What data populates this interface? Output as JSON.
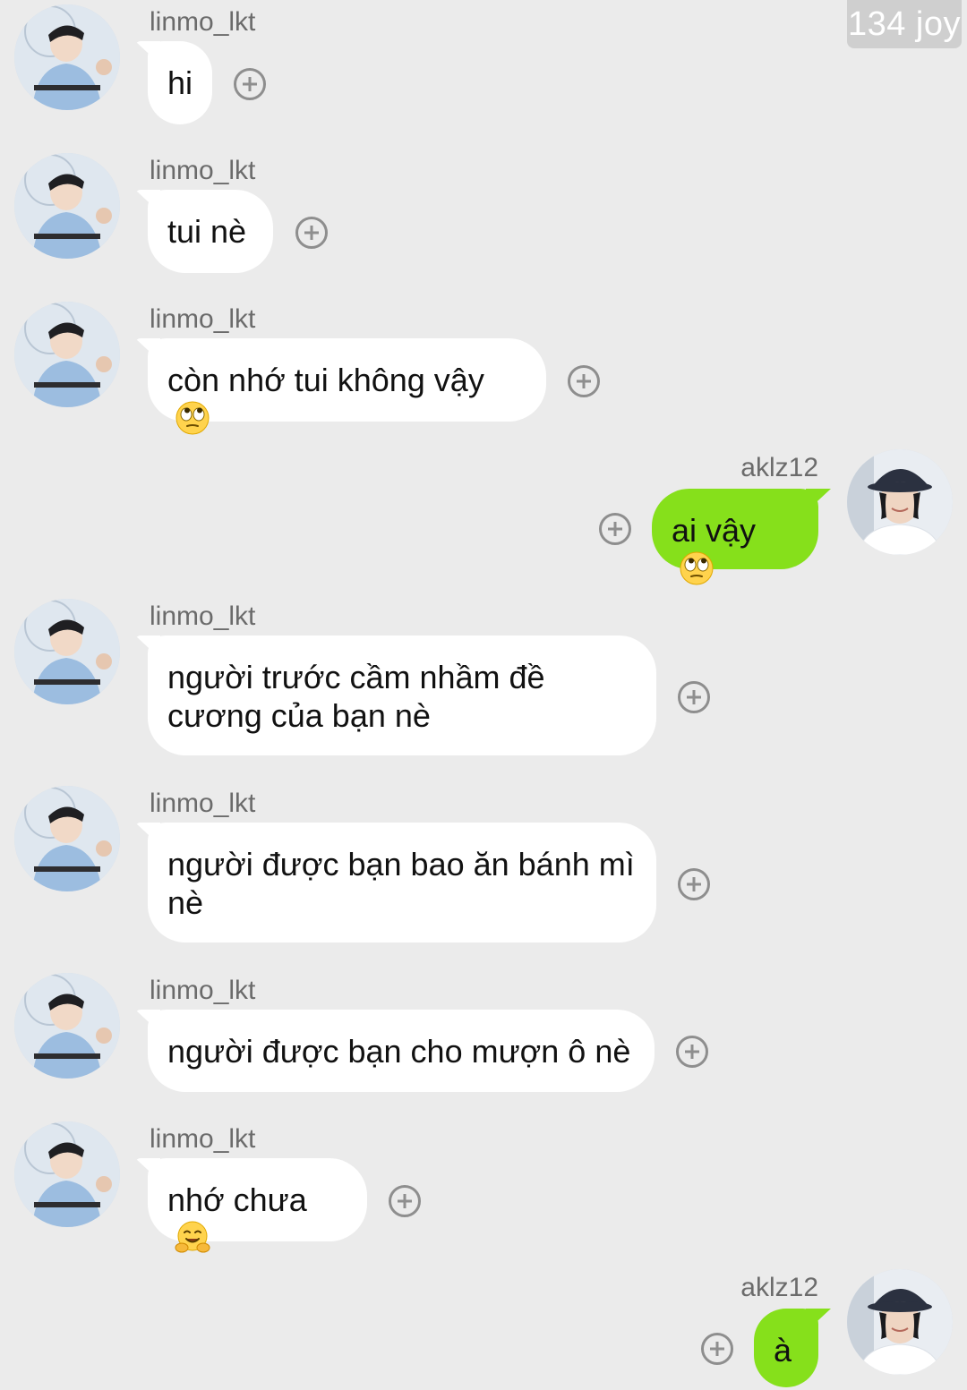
{
  "watermark": "134 joy",
  "messages": [
    {
      "sender": "linmo_lkt",
      "text": "hi",
      "emoji": "",
      "direction": "incoming"
    },
    {
      "sender": "linmo_lkt",
      "text": "tui nè",
      "emoji": "",
      "direction": "incoming"
    },
    {
      "sender": "linmo_lkt",
      "text": "còn nhớ tui không vậy",
      "emoji": "eye-roll-emoji",
      "direction": "incoming"
    },
    {
      "sender": "aklz12",
      "text": "ai vậy",
      "emoji": "eye-roll-emoji",
      "direction": "outgoing"
    },
    {
      "sender": "linmo_lkt",
      "text": "người trước cầm nhầm đề cương của bạn nè",
      "emoji": "",
      "direction": "incoming"
    },
    {
      "sender": "linmo_lkt",
      "text": "người được bạn bao ăn bánh mì nè",
      "emoji": "",
      "direction": "incoming"
    },
    {
      "sender": "linmo_lkt",
      "text": "người được bạn cho mượn ô nè",
      "emoji": "",
      "direction": "incoming"
    },
    {
      "sender": "linmo_lkt",
      "text": "nhớ chưa",
      "emoji": "hugging-face-emoji",
      "direction": "incoming"
    },
    {
      "sender": "aklz12",
      "text": "à",
      "emoji": "",
      "direction": "outgoing"
    }
  ],
  "icons": {
    "react": "add-reaction-icon",
    "avatar_incoming": "avatar-linmo",
    "avatar_outgoing": "avatar-aklz12"
  },
  "colors": {
    "background": "#ebebeb",
    "incoming_bubble": "#ffffff",
    "outgoing_bubble": "#86e01b",
    "sender_name": "#6b6b6b"
  }
}
